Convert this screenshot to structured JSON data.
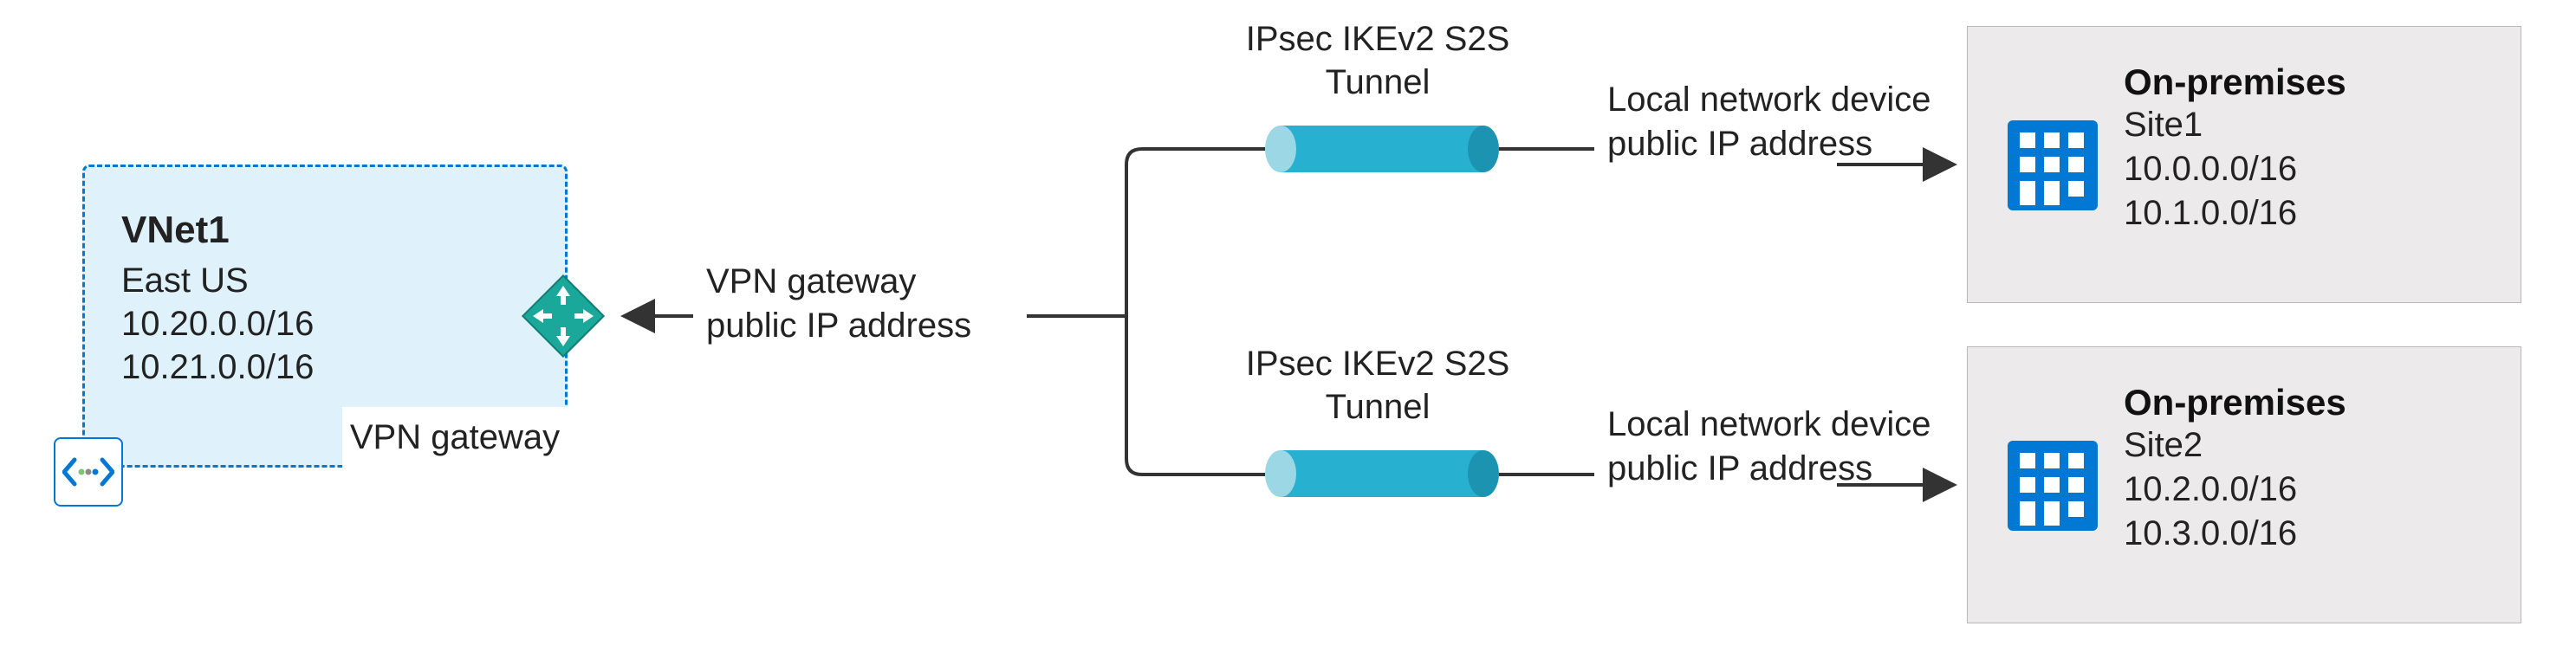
{
  "vnet": {
    "title": "VNet1",
    "region": "East US",
    "cidr1": "10.20.0.0/16",
    "cidr2": "10.21.0.0/16",
    "gateway_label": "VPN gateway"
  },
  "vpn_gateway": {
    "line1": "VPN gateway",
    "line2": "public IP address"
  },
  "tunnels": {
    "top": {
      "line1": "IPsec IKEv2 S2S",
      "line2": "Tunnel"
    },
    "bottom": {
      "line1": "IPsec IKEv2 S2S",
      "line2": "Tunnel"
    }
  },
  "local_devices": {
    "top": {
      "line1": "Local network device",
      "line2": "public IP address"
    },
    "bottom": {
      "line1": "Local network device",
      "line2": "public IP address"
    }
  },
  "sites": {
    "top": {
      "heading": "On-premises",
      "name": "Site1",
      "cidr1": "10.0.0.0/16",
      "cidr2": "10.1.0.0/16"
    },
    "bottom": {
      "heading": "On-premises",
      "name": "Site2",
      "cidr1": "10.2.0.0/16",
      "cidr2": "10.3.0.0/16"
    }
  },
  "colors": {
    "azure_blue": "#0078d4",
    "vnet_fill": "#dff1fb",
    "teal": "#19a89a",
    "tunnel": "#28b0d0",
    "site_bg": "#eceaea"
  }
}
